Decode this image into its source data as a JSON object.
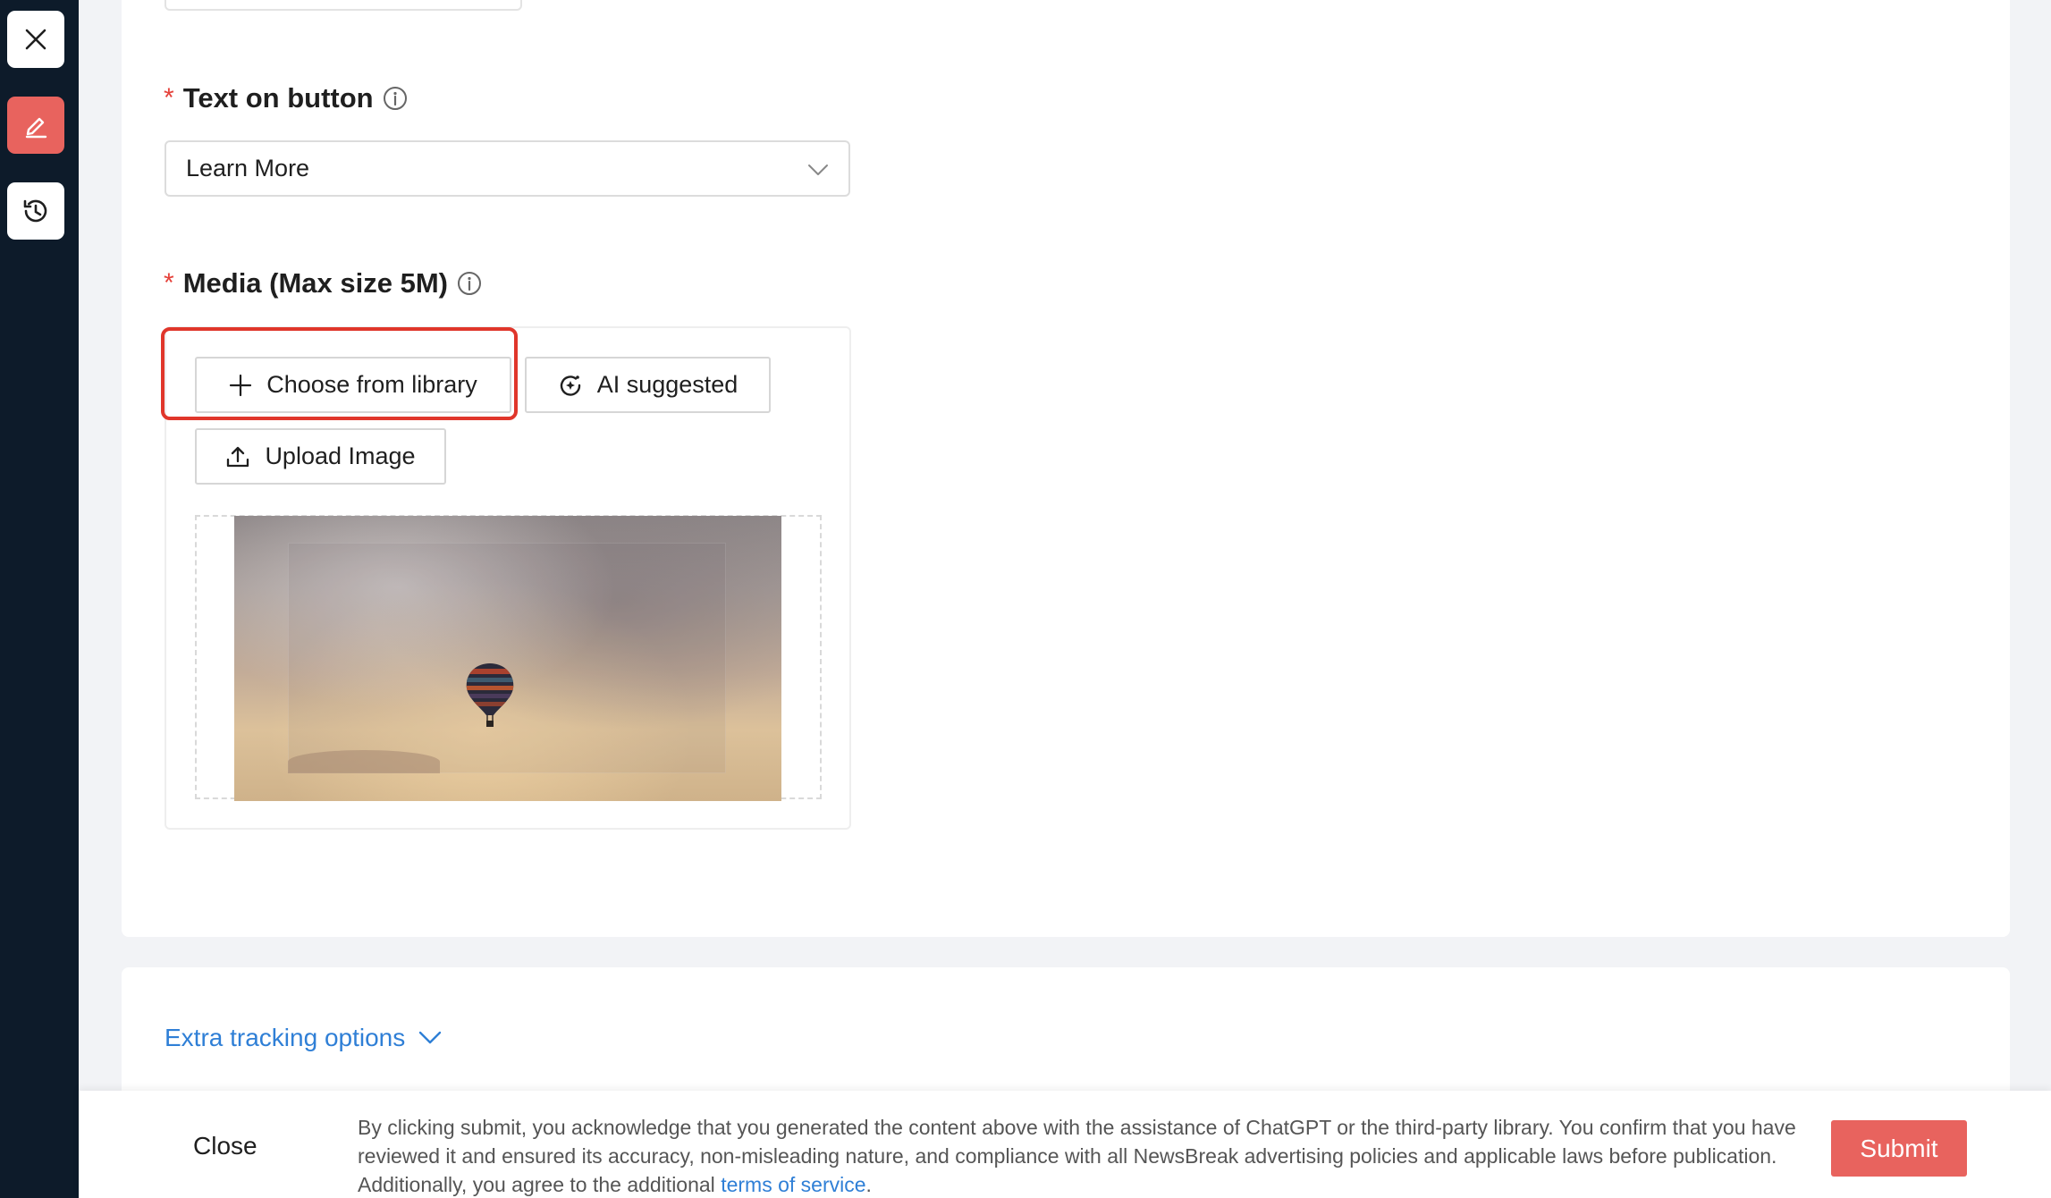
{
  "sidebar": {
    "items": [
      {
        "icon": "close-icon"
      },
      {
        "icon": "edit-icon",
        "active": true
      },
      {
        "icon": "history-icon"
      }
    ]
  },
  "form": {
    "button_text": {
      "label": "Text on button",
      "required_mark": "*",
      "value": "Learn More"
    },
    "media": {
      "label": "Media (Max size 5M)",
      "required_mark": "*",
      "buttons": {
        "choose": "Choose from library",
        "ai": "AI suggested",
        "upload": "Upload Image"
      }
    }
  },
  "extra_tracking": {
    "label": "Extra tracking options"
  },
  "footer": {
    "close_label": "Close",
    "disclaimer_text": "By clicking submit, you acknowledge that you generated the content above with the assistance of ChatGPT or the third-party library. You confirm that you have reviewed it and ensured its accuracy, non-misleading nature, and compliance with all NewsBreak advertising policies and applicable laws before publication. Additionally, you agree to the additional ",
    "terms_link": "terms of service",
    "disclaimer_end": ".",
    "submit_label": "Submit"
  },
  "colors": {
    "accent": "#e8635e",
    "link": "#2f7fd6",
    "required": "#e5413a",
    "highlight": "#e0362b",
    "rail": "#0d1b2a"
  }
}
